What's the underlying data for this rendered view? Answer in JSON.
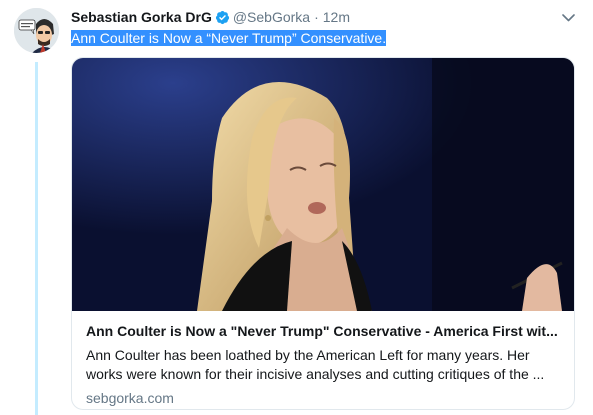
{
  "tweet": {
    "author_name": "Sebastian Gorka DrG",
    "handle": "@SebGorka",
    "separator": "·",
    "time": "12m",
    "text": "Ann Coulter is Now a “Never Trump” Conservative."
  },
  "card": {
    "title": "Ann Coulter is Now a \"Never Trump\" Conservative - America First wit...",
    "description_line1": "Ann Coulter has been loathed by the American Left for many years. Her",
    "description_line2": "works were known for their incisive analyses and cutting critiques of the ...",
    "domain": "sebgorka.com"
  },
  "icons": {
    "verified": "verified-badge-icon",
    "caret": "chevron-down-icon"
  },
  "colors": {
    "verified_blue": "#1da1f2",
    "selection_blue": "#3390ff",
    "thread_line": "#c4ecff",
    "muted_text": "#657786"
  }
}
